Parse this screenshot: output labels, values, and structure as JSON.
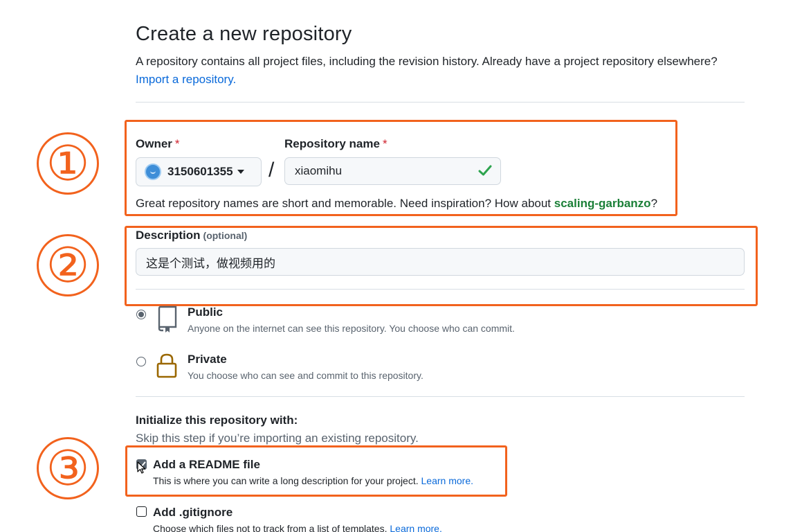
{
  "header": {
    "title": "Create a new repository",
    "subtitle": "A repository contains all project files, including the revision history. Already have a project repository elsewhere?",
    "import_link": "Import a repository."
  },
  "owner": {
    "label": "Owner",
    "required_mark": "*",
    "value": "3150601355",
    "avatar_icon": "avatar-icon"
  },
  "repo": {
    "label": "Repository name",
    "required_mark": "*",
    "value": "xiaomihu",
    "separator": "/"
  },
  "name_hint": {
    "text": "Great repository names are short and memorable. Need inspiration? How about",
    "suggestion": "scaling-garbanzo",
    "suffix": "?"
  },
  "description": {
    "label": "Description",
    "optional": "(optional)",
    "value": "这是个测试，做视频用的"
  },
  "visibility": [
    {
      "title": "Public",
      "desc": "Anyone on the internet can see this repository. You choose who can commit.",
      "selected": true,
      "icon": "repo-book-icon"
    },
    {
      "title": "Private",
      "desc": "You choose who can see and commit to this repository.",
      "selected": false,
      "icon": "lock-icon"
    }
  ],
  "init": {
    "title": "Initialize this repository with:",
    "subtitle": "Skip this step if you’re importing an existing repository.",
    "readme": {
      "title": "Add a README file",
      "desc": "This is where you can write a long description for your project.",
      "link": "Learn more.",
      "checked": true
    },
    "gitignore": {
      "title": "Add .gitignore",
      "desc": "Choose which files not to track from a list of templates.",
      "link": "Learn more.",
      "checked": false
    }
  },
  "annotations": {
    "step1": "①",
    "step2": "②",
    "step3": "③",
    "color": "#f2621d"
  },
  "colors": {
    "link": "#0969da",
    "required": "#cf222e",
    "success": "#1a7f37",
    "annotation": "#f2621d"
  }
}
